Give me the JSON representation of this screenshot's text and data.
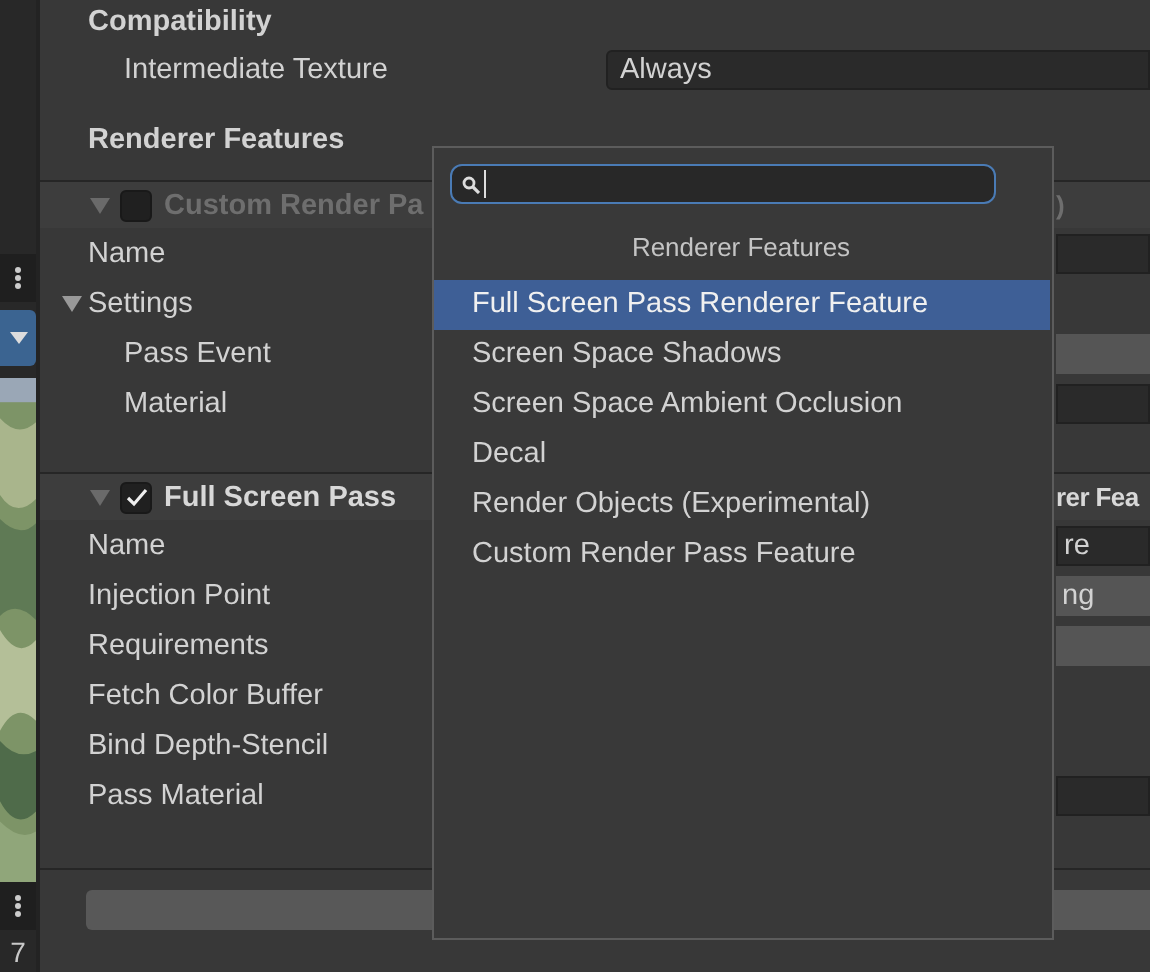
{
  "side_panel": {
    "footer_text": "7"
  },
  "compatibility": {
    "title": "Compatibility",
    "intermediate_texture": {
      "label": "Intermediate Texture",
      "value": "Always"
    }
  },
  "renderer_features": {
    "title": "Renderer Features",
    "features": [
      {
        "name": "Custom Render Pa",
        "name_tail": ")",
        "checked": false,
        "expanded": true,
        "properties": [
          {
            "label": "Name",
            "kind": "text"
          },
          {
            "label": "Settings",
            "kind": "group",
            "expanded": true,
            "children": [
              {
                "label": "Pass Event",
                "kind": "dropdown"
              },
              {
                "label": "Material",
                "kind": "object"
              }
            ]
          }
        ]
      },
      {
        "name": "Full Screen Pass",
        "name_tail": "rer Fea",
        "checked": true,
        "expanded": true,
        "properties": [
          {
            "label": "Name",
            "kind": "text",
            "value": "re"
          },
          {
            "label": "Injection Point",
            "kind": "dropdown",
            "value": "ng"
          },
          {
            "label": "Requirements",
            "kind": "dropdown"
          },
          {
            "label": "Fetch Color Buffer",
            "kind": "toggle"
          },
          {
            "label": "Bind Depth-Stencil",
            "kind": "toggle"
          },
          {
            "label": "Pass Material",
            "kind": "object"
          }
        ]
      }
    ]
  },
  "popup": {
    "title": "Renderer Features",
    "items": [
      {
        "label": "Full Screen Pass Renderer Feature",
        "selected": true
      },
      {
        "label": "Screen Space Shadows",
        "selected": false
      },
      {
        "label": "Screen Space Ambient Occlusion",
        "selected": false
      },
      {
        "label": "Decal",
        "selected": false
      },
      {
        "label": "Render Objects (Experimental)",
        "selected": false
      },
      {
        "label": "Custom Render Pass Feature",
        "selected": false
      }
    ]
  }
}
